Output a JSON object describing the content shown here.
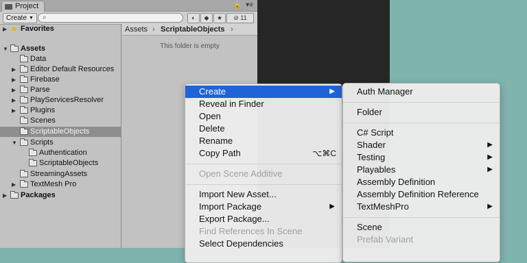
{
  "project_panel": {
    "tab_label": "Project",
    "toolbar": {
      "create_label": "Create",
      "search_value": "",
      "hidden_count": "11"
    },
    "tree": [
      {
        "label": "Favorites"
      },
      {
        "label": "Assets"
      },
      {
        "label": "Data"
      },
      {
        "label": "Editor Default Resources"
      },
      {
        "label": "Firebase"
      },
      {
        "label": "Parse"
      },
      {
        "label": "PlayServicesResolver"
      },
      {
        "label": "Plugins"
      },
      {
        "label": "Scenes"
      },
      {
        "label": "ScriptableObjects"
      },
      {
        "label": "Scripts"
      },
      {
        "label": "Authentication"
      },
      {
        "label": "ScriptableObjects"
      },
      {
        "label": "StreamingAssets"
      },
      {
        "label": "TextMesh Pro"
      },
      {
        "label": "Packages"
      }
    ],
    "breadcrumb": {
      "root": "Assets",
      "current": "ScriptableObjects"
    },
    "empty_message": "This folder is empty"
  },
  "context_menu": {
    "items": [
      {
        "label": "Create"
      },
      {
        "label": "Reveal in Finder"
      },
      {
        "label": "Open"
      },
      {
        "label": "Delete"
      },
      {
        "label": "Rename"
      },
      {
        "label": "Copy Path",
        "shortcut": "⌥⌘C"
      },
      {
        "label": "Open Scene Additive"
      },
      {
        "label": "Import New Asset..."
      },
      {
        "label": "Import Package"
      },
      {
        "label": "Export Package..."
      },
      {
        "label": "Find References In Scene"
      },
      {
        "label": "Select Dependencies"
      }
    ]
  },
  "create_submenu": {
    "items": [
      {
        "label": "Auth Manager"
      },
      {
        "label": "Folder"
      },
      {
        "label": "C# Script"
      },
      {
        "label": "Shader"
      },
      {
        "label": "Testing"
      },
      {
        "label": "Playables"
      },
      {
        "label": "Assembly Definition"
      },
      {
        "label": "Assembly Definition Reference"
      },
      {
        "label": "TextMeshPro"
      },
      {
        "label": "Scene"
      },
      {
        "label": "Prefab Variant"
      }
    ]
  },
  "colors": {
    "highlight": "#1e63d8",
    "panel_bg": "#c2c2c2",
    "scene_bg": "#7fb3ad",
    "dark_bg": "#262626"
  }
}
